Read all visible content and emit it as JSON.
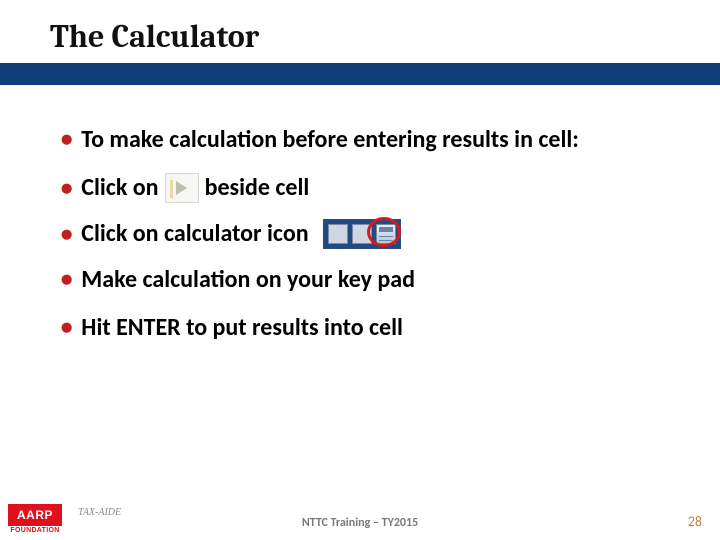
{
  "slide": {
    "title": "The Calculator",
    "bullets": [
      {
        "text": "To make calculation before entering results in cell:"
      },
      {
        "prefix": "Click on",
        "suffix": "beside cell"
      },
      {
        "text": "Click on calculator icon"
      },
      {
        "text": "Make calculation on your key pad"
      },
      {
        "text": "Hit ENTER to put results into cell"
      }
    ]
  },
  "footer": {
    "logo": "AARP",
    "logo_sub": "FOUNDATION",
    "tax_aide": "TAX-AIDE",
    "center": "NTTC Training – TY2015",
    "page": "28"
  }
}
